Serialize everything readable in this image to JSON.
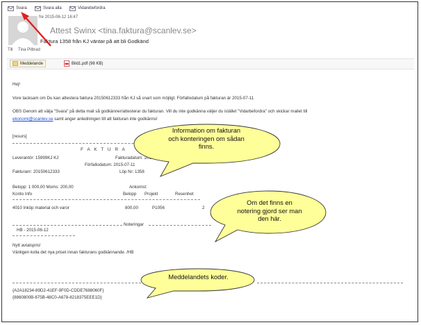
{
  "toolbar": {
    "reply_label": "Svara",
    "reply_all_label": "Svara alla",
    "forward_label": "Vidarebefordra"
  },
  "header": {
    "date": "fre 2015-06-12 16:47",
    "sender": "Attest Swinx <tina.faktura@scanlev.se>",
    "subject": "Faktura 1358 från KJ väntar på att bli Godkänd",
    "to_label": "Till",
    "to_name": "Tina Pilbrad"
  },
  "attachments": {
    "message_label": "Meddelande",
    "pdf_label": "Bild1.pdf (98 KB)"
  },
  "body": {
    "greeting": "Hej!",
    "line1": "Vore tacksam om Du kan attestera faktura 20150612333 från KJ så snart som möjligt. Förfallodatum på fakturan är 2015-07-11",
    "line2": "OBS Genom att välja \"Svara\" på detta mail så godkänner/attesterar du fakturan. Vill du inte godkänna väljer du istället \"Vidarbefordra\" och skickar mailet till",
    "email_link": "ekonomi@scanlev.se",
    "line3_rest": " samt anger anledningen till att fakturan inte godkänns!",
    "resurs": "[resurs]",
    "faktura_heading": "F A K T U R A",
    "leverantor": "Leverantör: 15999KJ KJ",
    "fakturadatum": "Fakturadatum:  2015-06-",
    "forfallodatum": "Förfallodatum: 2015-07-11",
    "fakturanr": "Fakturanr: 20150612333",
    "lopnr": "Löp Nr:  1358",
    "belopp": "Belopp: 1 000,00   Moms: 200,00",
    "ankomst": "Ankomst:",
    "col_konto": "Konto Info",
    "col_belopp": "Belopp",
    "col_projekt": "Projekt",
    "col_resenhet": "Resenhet",
    "row_konto": "4010  Inköp material och varor",
    "row_belopp": "800,00",
    "row_projekt": "P1056",
    "row_resenhet": "2",
    "noteringar": "Noteringar",
    "note_head": "HB - 2015-06-12",
    "note_line1": "Nytt avtalspris!",
    "note_line2": "Vänligen kolla det nya priset innan fakturans godkännande. /HB",
    "code1": "{A2A18234-89D2-41EF-9F0D-CDDE7688060F}",
    "code2": "{8860800B-875B-48C0-A678-8218375EEE1D}"
  },
  "callouts": {
    "invoice_info": "Information om fakturan och konteringen om sådan finns.",
    "invoice_info_l1": "Information om fakturan",
    "invoice_info_l2": "och konteringen om sådan",
    "invoice_info_l3": "finns.",
    "note_l1": "Om det finns en",
    "note_l2": "notering gjord ser man",
    "note_l3": "den här.",
    "codes": "Meddelandets koder."
  },
  "colors": {
    "callout_fill": "#ffff99",
    "arrow": "#e0201a",
    "link": "#1a4fcf"
  }
}
